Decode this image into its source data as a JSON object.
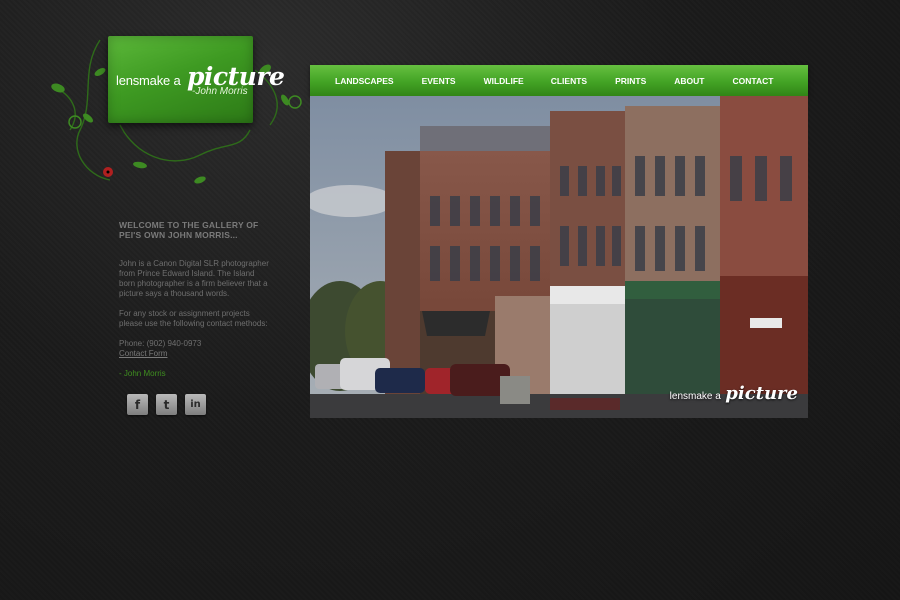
{
  "logo": {
    "prefix": "lensmake a",
    "main": "picture",
    "author": "-John Morris"
  },
  "nav": {
    "items": [
      "LANDSCAPES",
      "EVENTS",
      "WILDLIFE",
      "CLIENTS",
      "PRINTS",
      "ABOUT",
      "CONTACT"
    ]
  },
  "sidebar": {
    "heading": "WELCOME TO THE GALLERY OF PEI'S OWN JOHN MORRIS...",
    "intro": "John is a Canon Digital SLR photographer from Prince Edward Island. The Island born photographer is a firm believer that a picture says a thousand words.",
    "projects": "For any stock or assignment projects please use the following contact methods:",
    "phone": "Phone: (902) 940-0973",
    "contact_link": "Contact Form",
    "signature": "- John Morris"
  },
  "social": [
    {
      "icon": "facebook-icon",
      "glyph": "f"
    },
    {
      "icon": "twitter-icon",
      "glyph": "t"
    },
    {
      "icon": "linkedin-icon",
      "glyph": "in"
    }
  ],
  "hero": {
    "logo_prefix": "lensmake a",
    "logo_main": "picture"
  },
  "colors": {
    "accent": "#3e9a22",
    "background": "#1b1b1b"
  }
}
